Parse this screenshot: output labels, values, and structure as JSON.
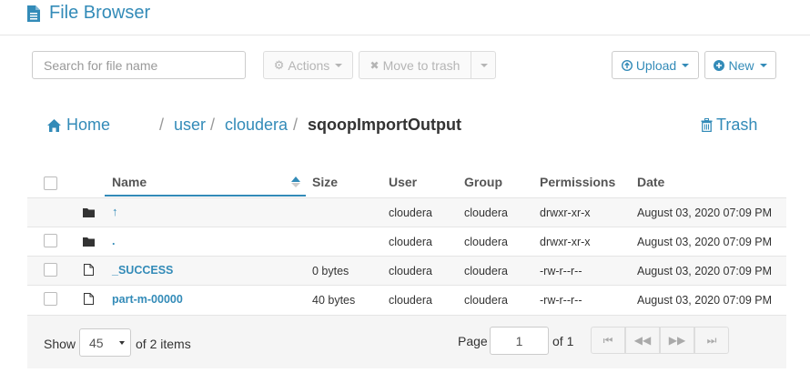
{
  "header": {
    "title": "File Browser"
  },
  "toolbar": {
    "search_placeholder": "Search for file name",
    "actions_label": "Actions",
    "move_to_trash_label": "Move to trash",
    "upload_label": "Upload",
    "new_label": "New"
  },
  "breadcrumb": {
    "home": "Home",
    "separator": "/",
    "segments": [
      "user",
      "cloudera",
      "sqoopImportOutput"
    ],
    "trash": "Trash"
  },
  "table": {
    "columns": [
      "Name",
      "Size",
      "User",
      "Group",
      "Permissions",
      "Date"
    ],
    "rows": [
      {
        "name": "↑",
        "size": "",
        "user": "cloudera",
        "group": "cloudera",
        "permissions": "drwxr-xr-x",
        "date": "August 03, 2020 07:09 PM"
      },
      {
        "name": ".",
        "size": "",
        "user": "cloudera",
        "group": "cloudera",
        "permissions": "drwxr-xr-x",
        "date": "August 03, 2020 07:09 PM"
      },
      {
        "name": "_SUCCESS",
        "size": "0 bytes",
        "user": "cloudera",
        "group": "cloudera",
        "permissions": "-rw-r--r--",
        "date": "August 03, 2020 07:09 PM"
      },
      {
        "name": "part-m-00000",
        "size": "40 bytes",
        "user": "cloudera",
        "group": "cloudera",
        "permissions": "-rw-r--r--",
        "date": "August 03, 2020 07:09 PM"
      }
    ]
  },
  "footer": {
    "show_label": "Show",
    "page_size": "45",
    "items_label": "of 2 items",
    "page_label": "Page",
    "page_value": "1",
    "of_pages": "of 1"
  }
}
